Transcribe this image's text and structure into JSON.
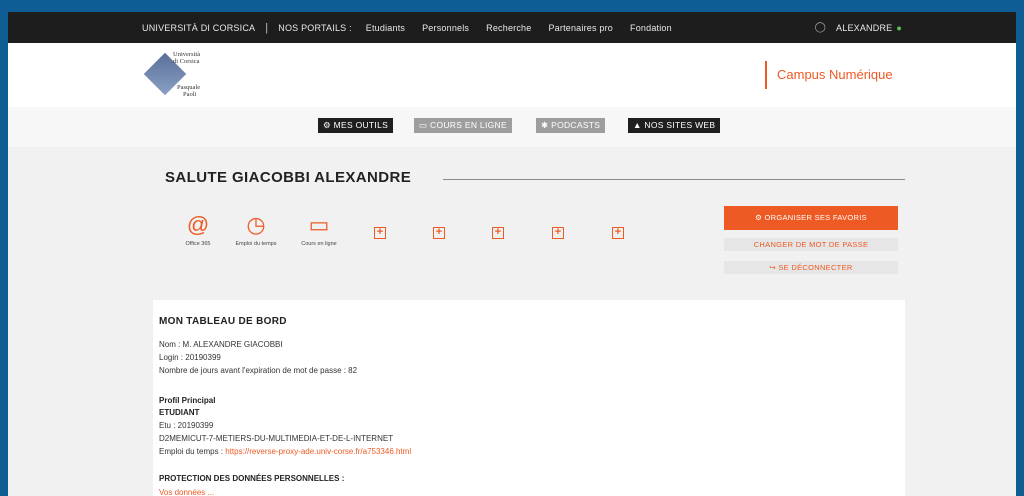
{
  "topbar": {
    "brand": "UNIVERSITÀ DI CORSICA",
    "separator": "|",
    "portals": "NOS PORTAILS :",
    "links": [
      "Etudiants",
      "Personnels",
      "Recherche",
      "Partenaires pro",
      "Fondation"
    ],
    "username": "ALEXANDRE"
  },
  "logo": {
    "line1": "Università",
    "line2": "di Corsica",
    "line3": "Pasquale",
    "line4": "Paoli"
  },
  "header": {
    "campus": "Campus Numérique"
  },
  "nav": {
    "outils": "MES OUTILS",
    "cours": "COURS EN LIGNE",
    "podcasts": "PODCASTS",
    "sites": "NOS SITES WEB"
  },
  "main": {
    "name": "SALUTE GIACOBBI ALEXANDRE",
    "apps": [
      {
        "label": "Office 365",
        "icon": "at-icon"
      },
      {
        "label": "Emploi du temps",
        "icon": "clock-icon"
      },
      {
        "label": "Cours en ligne",
        "icon": "monitor-icon"
      }
    ],
    "buttons": {
      "favoris": "ORGANISER SES FAVORIS",
      "password": "CHANGER DE MOT DE PASSE",
      "logout": "SE DÉCONNECTER"
    }
  },
  "dashboard": {
    "title": "MON TABLEAU DE BORD",
    "nom": "Nom : M. ALEXANDRE GIACOBBI",
    "login": "Login : 20190399",
    "expiration": "Nombre de jours avant l'expiration de mot de passe : 82",
    "profil_title": "Profil Principal",
    "profil_type": "ETUDIANT",
    "etu": "Etu : 20190399",
    "formation": "D2MEMICUT-7-METIERS-DU-MULTIMEDIA-ET-DE-L-INTERNET",
    "emploi_label": "Emploi du temps : ",
    "emploi_link": "https://reverse-proxy-ade.univ-corse.fr/a753346.html",
    "protection_title": "PROTECTION DES DONNÉES PERSONNELLES :",
    "protection_text": "Vos données ... "
  },
  "colors": {
    "accent": "#ee5a24",
    "topbar": "#1d1d1d",
    "outer": "#0f5d95"
  }
}
